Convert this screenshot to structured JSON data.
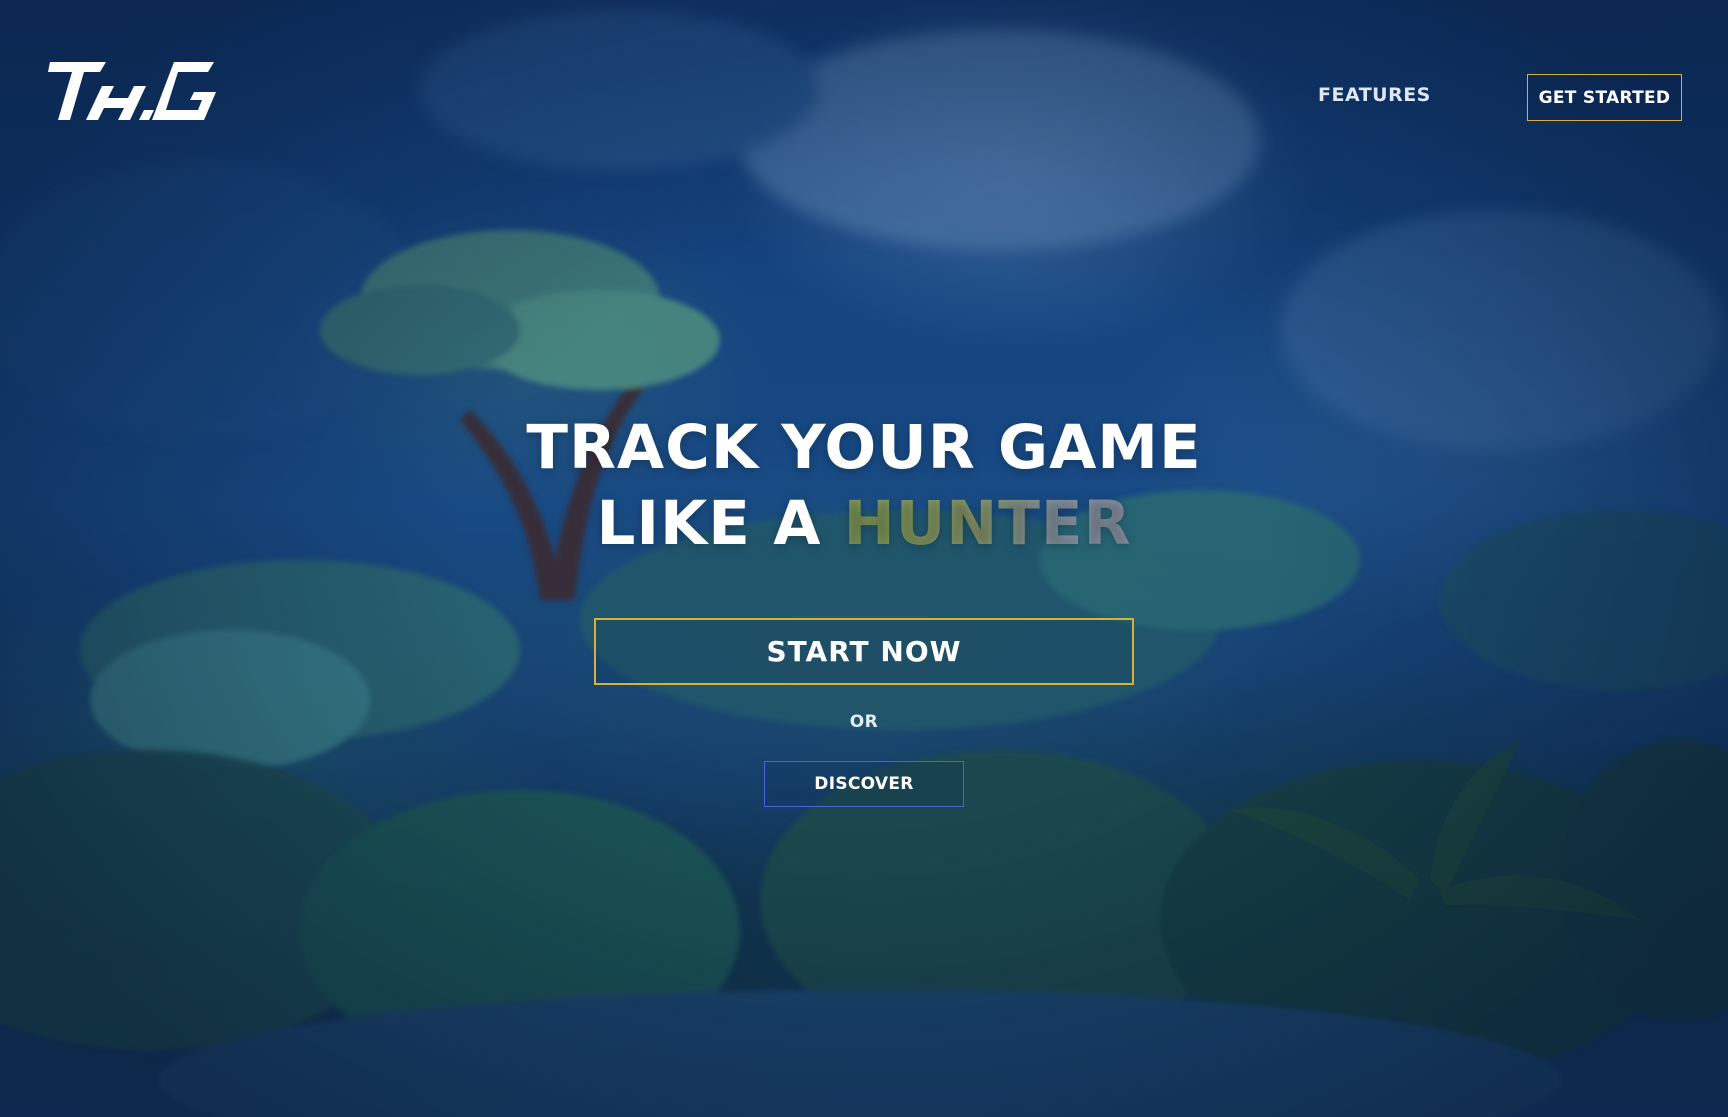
{
  "brand": {
    "logo_text": "TH.G",
    "logo_color": "#ffffff"
  },
  "nav": {
    "features_label": "FEATURES",
    "get_started_label": "GET STARTED"
  },
  "hero": {
    "line1": "TRACK YOUR GAME",
    "line2_prefix": "LIKE A ",
    "line2_accent": "HUNTER",
    "start_label": "START NOW",
    "or_label": "OR",
    "discover_label": "DISCOVER"
  },
  "colors": {
    "accent_gold": "#d6b13a",
    "accent_blue": "#4a63d8",
    "background_blue": "#15447f",
    "text_white": "#ffffff"
  },
  "background": {
    "description_icon": "misty-jungle-illustration"
  }
}
